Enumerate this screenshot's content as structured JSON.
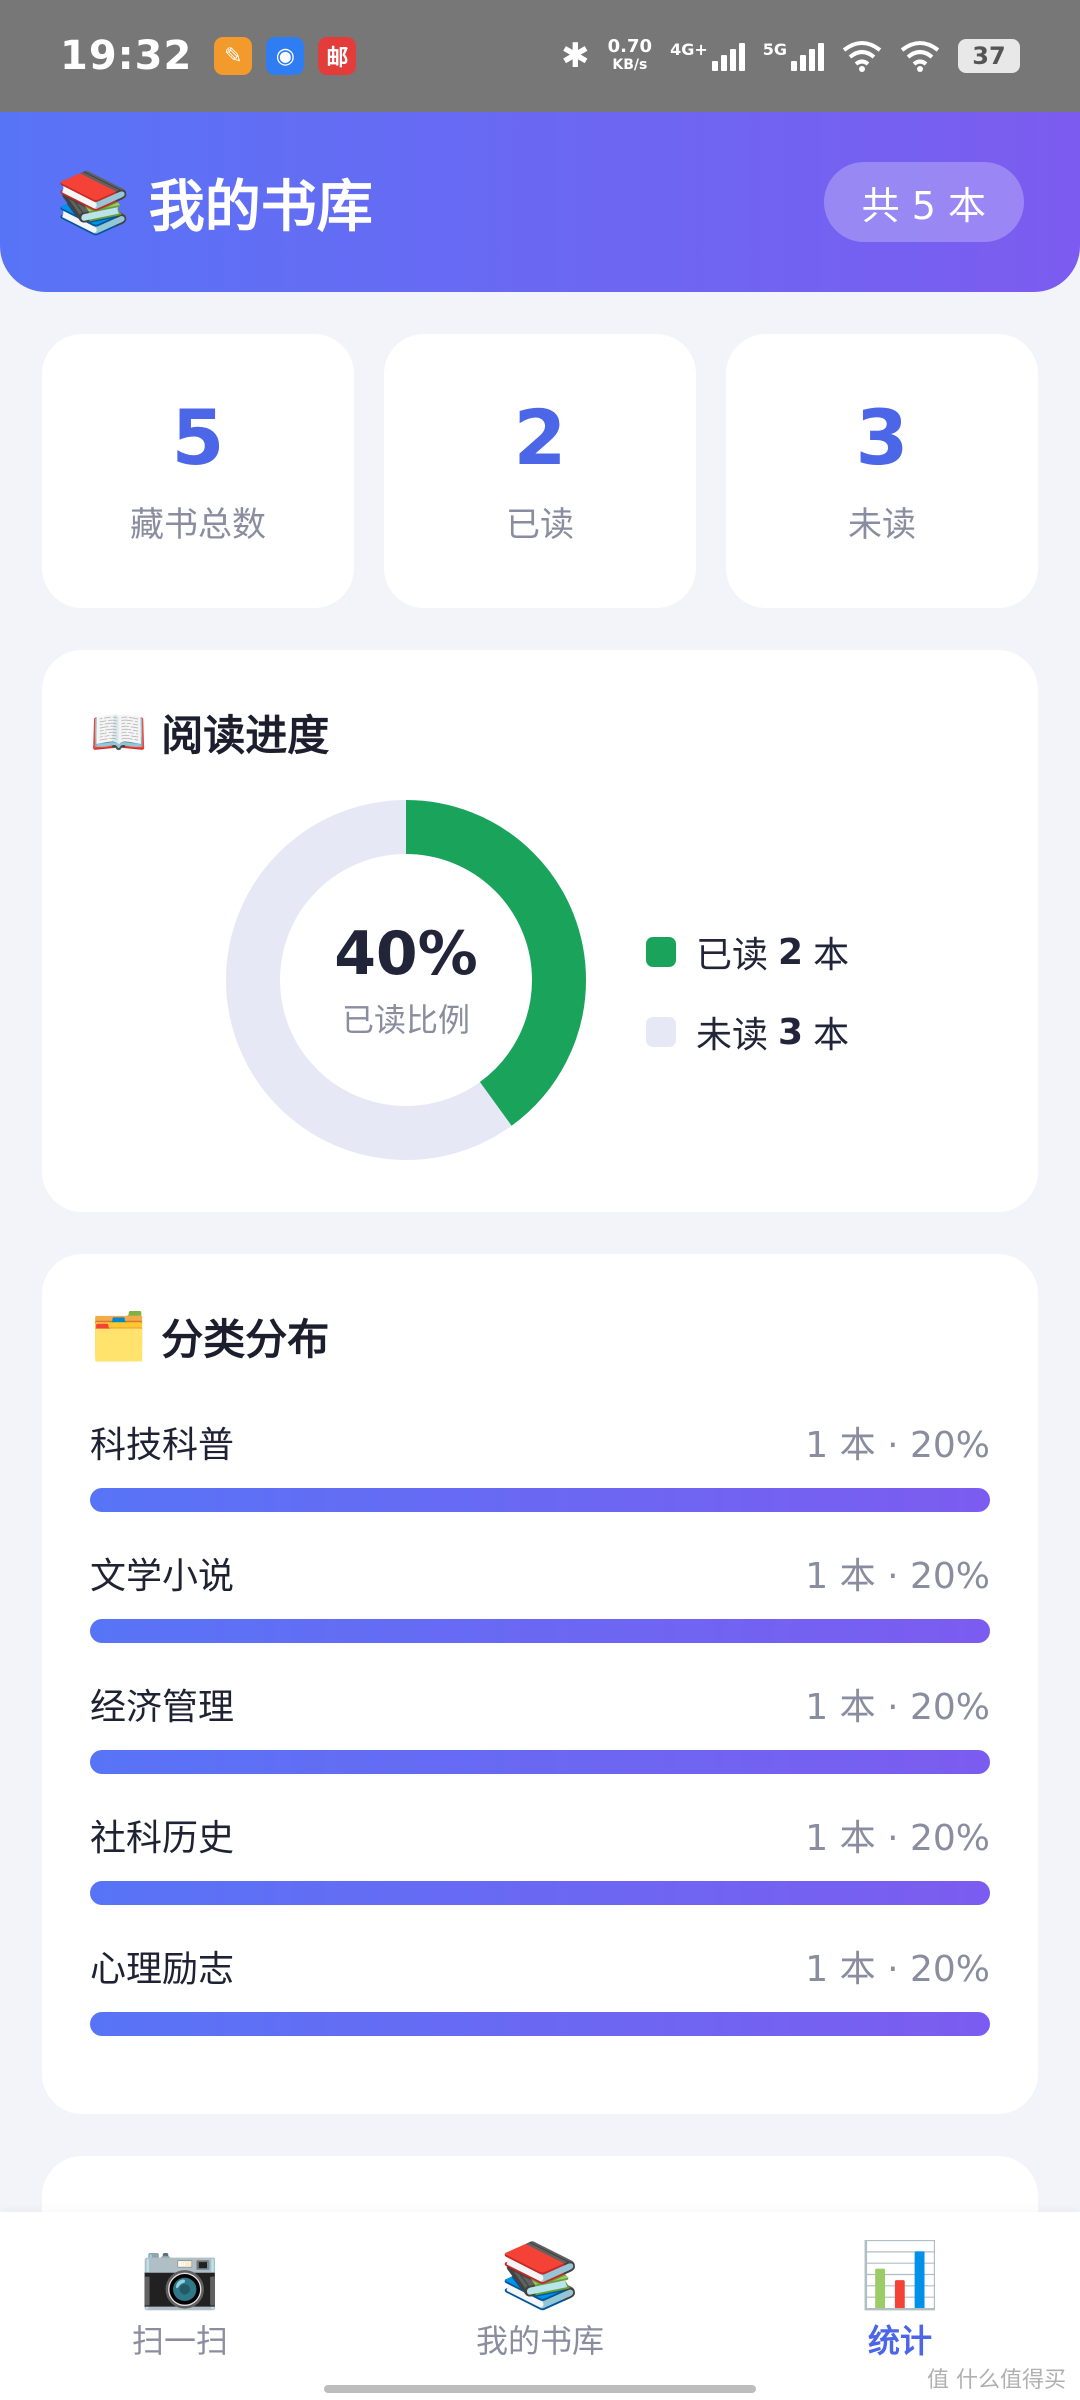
{
  "status_bar": {
    "time": "19:32",
    "network_speed_value": "0.70",
    "network_speed_unit": "KB/s",
    "sim1_type": "4G+",
    "sim2_type": "5G",
    "battery": "37",
    "app_icons": [
      "app-icon-orange",
      "app-icon-blue",
      "app-icon-red"
    ],
    "app_icon_red_text": "邮"
  },
  "header": {
    "icon": "📚",
    "title": "我的书库",
    "count_badge": "共 5 本"
  },
  "stats": [
    {
      "value": "5",
      "label": "藏书总数"
    },
    {
      "value": "2",
      "label": "已读"
    },
    {
      "value": "3",
      "label": "未读"
    }
  ],
  "reading_progress": {
    "icon": "📖",
    "title": "阅读进度",
    "percent_text": "40%",
    "percent_value": 40,
    "center_label": "已读比例",
    "read_color": "#1aa35a",
    "unread_color": "#e6e8f5",
    "legend": [
      {
        "prefix": "已读",
        "count": "2",
        "suffix": "本"
      },
      {
        "prefix": "未读",
        "count": "3",
        "suffix": "本"
      }
    ]
  },
  "category_distribution": {
    "icon": "🗂️",
    "title": "分类分布",
    "items": [
      {
        "name": "科技科普",
        "stat": "1 本 · 20%",
        "fraction": 1.0
      },
      {
        "name": "文学小说",
        "stat": "1 本 · 20%",
        "fraction": 1.0
      },
      {
        "name": "经济管理",
        "stat": "1 本 · 20%",
        "fraction": 1.0
      },
      {
        "name": "社科历史",
        "stat": "1 本 · 20%",
        "fraction": 1.0
      },
      {
        "name": "心理励志",
        "stat": "1 本 · 20%",
        "fraction": 1.0
      }
    ]
  },
  "bottom_nav": {
    "items": [
      {
        "icon": "📷",
        "label": "扫一扫",
        "active": false
      },
      {
        "icon": "📚",
        "label": "我的书库",
        "active": false
      },
      {
        "icon": "📊",
        "label": "统计",
        "active": true
      }
    ]
  },
  "watermark": "值 什么值得买",
  "colors": {
    "accent": "#4c66e8",
    "gradient_start": "#5874f6",
    "gradient_end": "#7c5cf0",
    "background": "#f3f4f9"
  }
}
